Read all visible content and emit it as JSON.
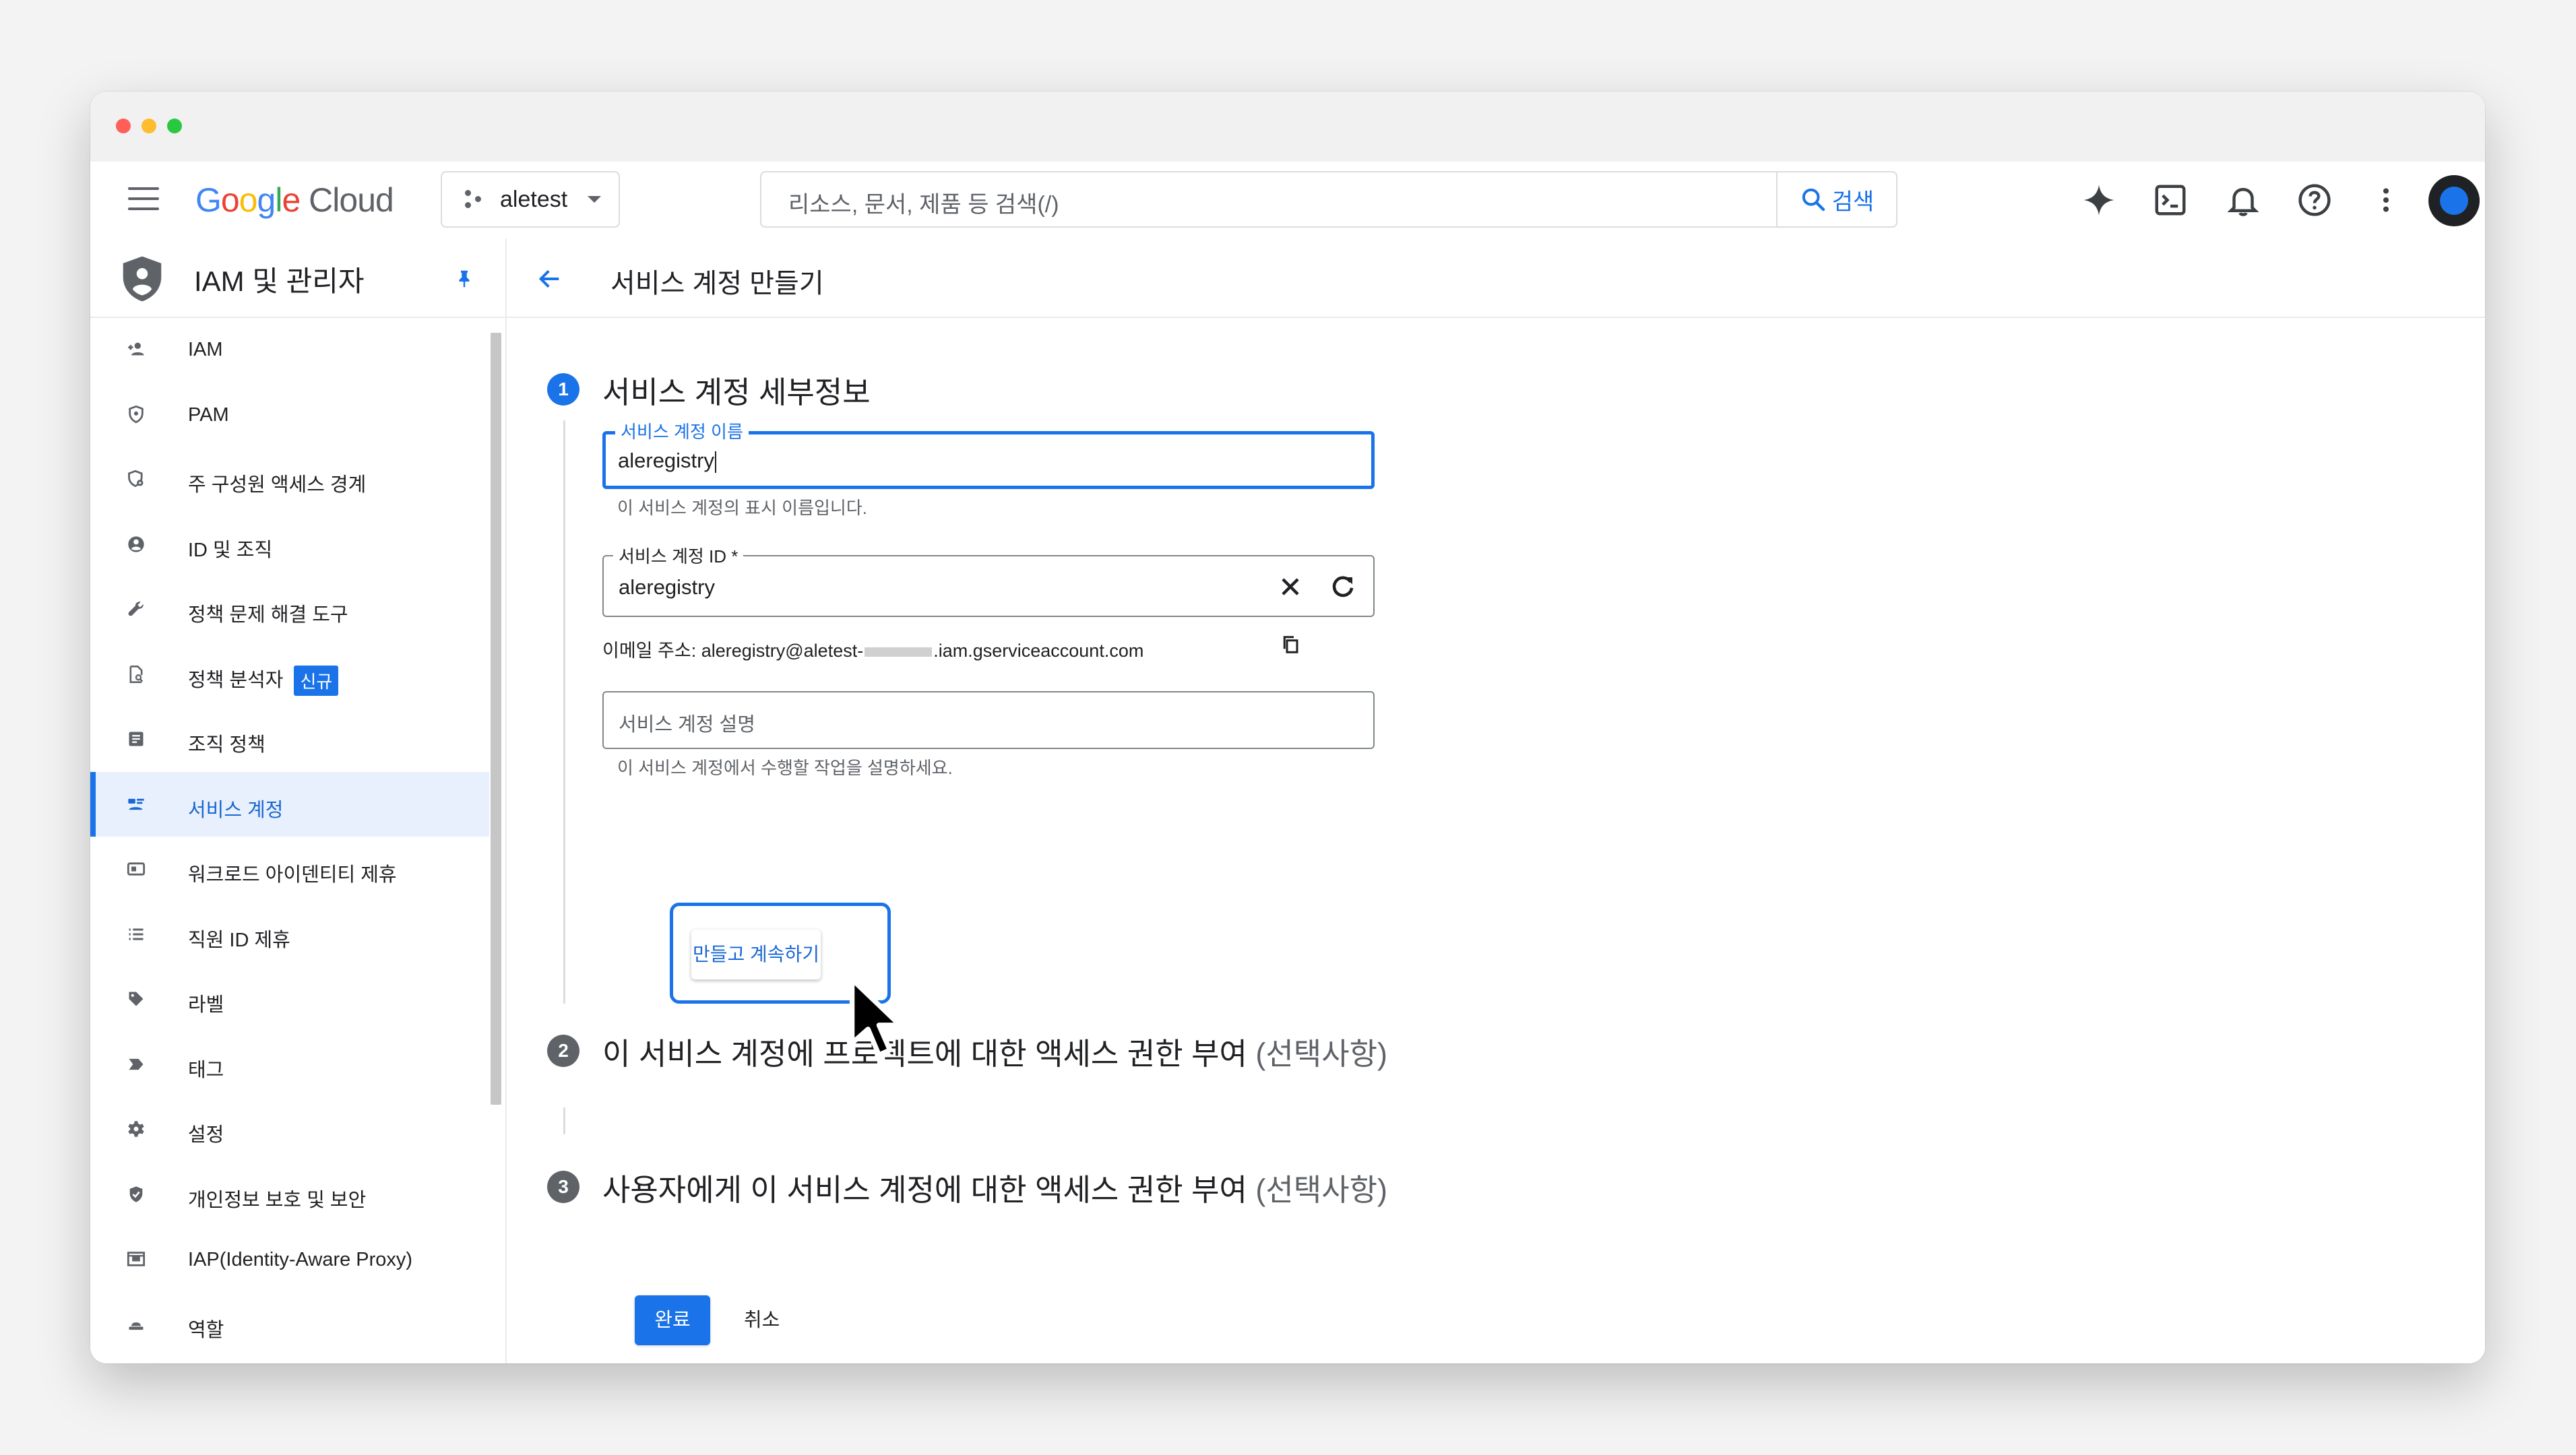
{
  "app": {
    "logo_google": "Google",
    "logo_cloud": "Cloud",
    "project_name": "aletest",
    "search_placeholder": "리소스, 문서, 제품 등 검색(/)",
    "search_button": "검색"
  },
  "sidebar": {
    "title": "IAM 및 관리자",
    "items": [
      {
        "label": "IAM",
        "icon": "add-person-icon"
      },
      {
        "label": "PAM",
        "icon": "shield-small-icon"
      },
      {
        "label": "주 구성원 액세스 경계",
        "icon": "shield-gear-icon"
      },
      {
        "label": "ID 및 조직",
        "icon": "account-circle-icon"
      },
      {
        "label": "정책 문제 해결 도구",
        "icon": "wrench-icon"
      },
      {
        "label": "정책 분석자",
        "icon": "doc-search-icon",
        "badge": "신규"
      },
      {
        "label": "조직 정책",
        "icon": "article-icon"
      },
      {
        "label": "서비스 계정",
        "icon": "service-account-icon",
        "active": true
      },
      {
        "label": "워크로드 아이덴티티 제휴",
        "icon": "id-card-icon"
      },
      {
        "label": "직원 ID 제휴",
        "icon": "list-icon"
      },
      {
        "label": "라벨",
        "icon": "label-icon"
      },
      {
        "label": "태그",
        "icon": "tag-arrow-icon"
      },
      {
        "label": "설정",
        "icon": "settings-icon"
      },
      {
        "label": "개인정보 보호 및 보안",
        "icon": "privacy-shield-icon"
      },
      {
        "label": "IAP(Identity-Aware Proxy)",
        "icon": "iap-icon"
      },
      {
        "label": "역할",
        "icon": "role-hat-icon"
      }
    ]
  },
  "page": {
    "title": "서비스 계정 만들기",
    "steps": [
      {
        "num": "1",
        "title": "서비스 계정 세부정보",
        "optional": ""
      },
      {
        "num": "2",
        "title": "이 서비스 계정에 프로젝트에 대한 액세스 권한 부여 ",
        "optional": "(선택사항)"
      },
      {
        "num": "3",
        "title": "사용자에게 이 서비스 계정에 대한 액세스 권한 부여 ",
        "optional": "(선택사항)"
      }
    ],
    "fields": {
      "name_label": "서비스 계정 이름",
      "name_value": "aleregistry",
      "name_helper": "이 서비스 계정의 표시 이름입니다.",
      "id_label": "서비스 계정 ID *",
      "id_value": "aleregistry",
      "email_prefix": "이메일 주소: aleregistry@aletest-",
      "email_suffix": ".iam.gserviceaccount.com",
      "desc_placeholder": "서비스 계정 설명",
      "desc_helper": "이 서비스 계정에서 수행할 작업을 설명하세요."
    },
    "buttons": {
      "create_continue": "만들고 계속하기",
      "done": "완료",
      "cancel": "취소"
    }
  },
  "colors": {
    "accent": "#1a73e8",
    "step_inactive": "#5f6368"
  }
}
